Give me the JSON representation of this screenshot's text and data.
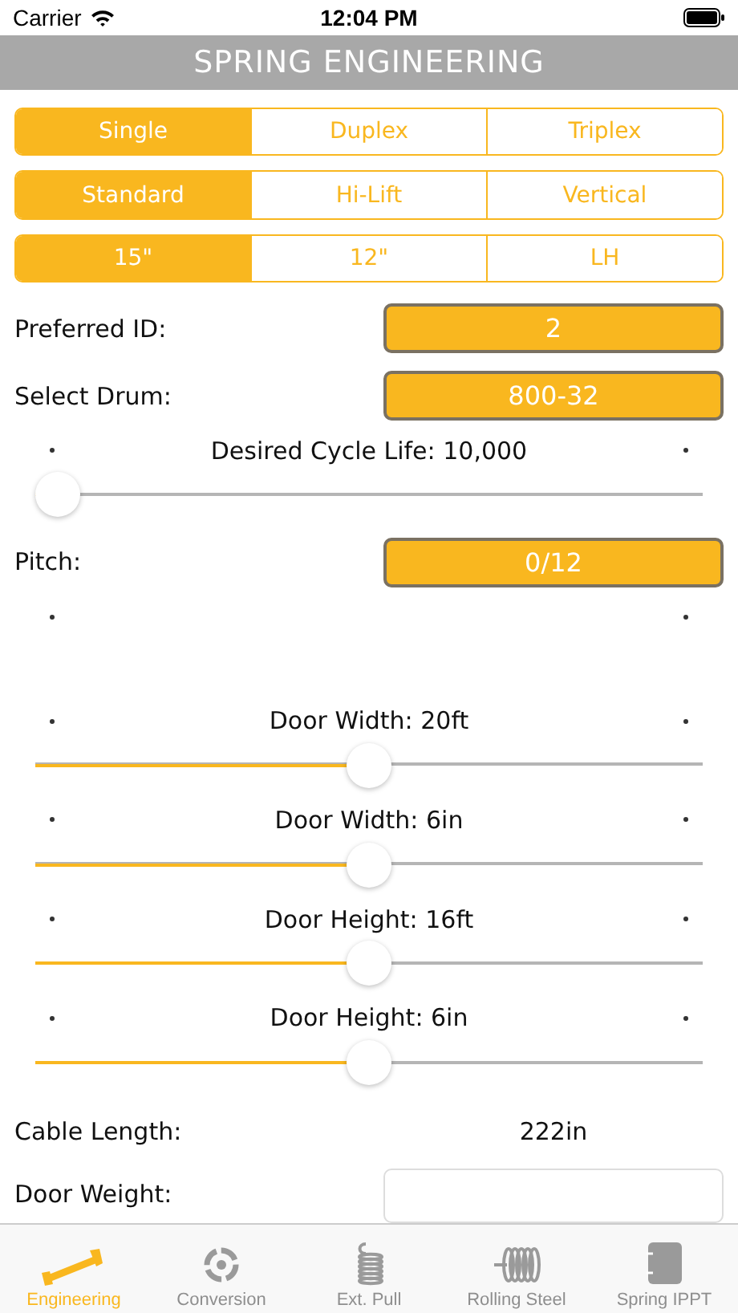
{
  "status_bar": {
    "carrier": "Carrier",
    "time": "12:04 PM"
  },
  "title": "SPRING ENGINEERING",
  "segment_groups": [
    {
      "options": [
        {
          "label": "Single",
          "selected": true
        },
        {
          "label": "Duplex",
          "selected": false
        },
        {
          "label": "Triplex",
          "selected": false
        }
      ]
    },
    {
      "options": [
        {
          "label": "Standard",
          "selected": true
        },
        {
          "label": "Hi-Lift",
          "selected": false
        },
        {
          "label": "Vertical",
          "selected": false
        }
      ]
    },
    {
      "options": [
        {
          "label": "15\"",
          "selected": true
        },
        {
          "label": "12\"",
          "selected": false
        },
        {
          "label": "LH",
          "selected": false
        }
      ]
    }
  ],
  "form": [
    {
      "kind": "picker",
      "label": "Preferred ID:",
      "value": "2"
    },
    {
      "kind": "picker",
      "label": "Select Drum:",
      "value": "800-32"
    },
    {
      "kind": "slider",
      "label": "Desired Cycle Life: 10,000",
      "level": 0.0
    },
    {
      "kind": "picker",
      "label": "Pitch:",
      "value": "0/12"
    },
    {
      "kind": "marks"
    },
    {
      "kind": "slider",
      "label": "Door Width: 20ft",
      "level": 0.5
    },
    {
      "kind": "slider",
      "label": "Door Width: 6in",
      "level": 0.5
    },
    {
      "kind": "slider",
      "label": "Door Height: 16ft",
      "level": 0.5
    },
    {
      "kind": "slider",
      "label": "Door Height: 6in",
      "level": 0.5
    },
    {
      "kind": "readout",
      "label": "Cable Length:",
      "value": "222in"
    },
    {
      "kind": "field",
      "label": "Door Weight:"
    }
  ],
  "tabs": [
    {
      "label": "Engineering",
      "selected": true
    },
    {
      "label": "Conversion",
      "selected": false
    },
    {
      "label": "Ext. Pull",
      "selected": false
    },
    {
      "label": "Rolling Steel",
      "selected": false
    },
    {
      "label": "Spring IPPT",
      "selected": false
    }
  ]
}
